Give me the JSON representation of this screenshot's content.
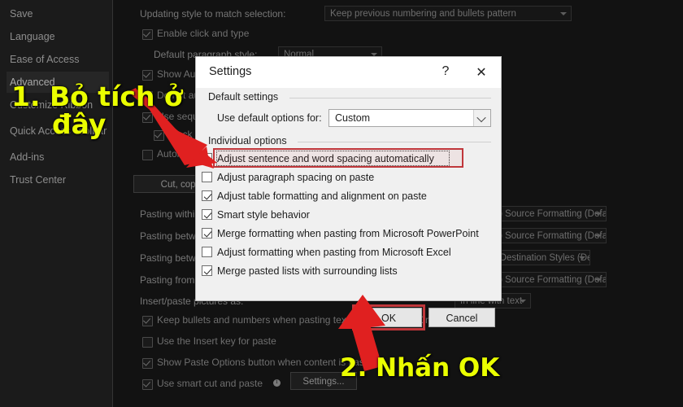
{
  "app": {
    "window_theme": "dark",
    "sidebar": {
      "items": [
        {
          "label": "Save",
          "selected": false
        },
        {
          "label": "Language",
          "selected": false
        },
        {
          "label": "Ease of Access",
          "selected": false
        },
        {
          "label": "Advanced",
          "selected": true
        },
        {
          "label": "Customize Ribbon",
          "selected": false
        },
        {
          "label": "Quick Access Toolbar",
          "selected": false
        },
        {
          "label": "Add-ins",
          "selected": false
        },
        {
          "label": "Trust Center",
          "selected": false
        }
      ]
    },
    "background": {
      "updating_style_label": "Updating style to match selection:",
      "updating_style_value": "Keep previous numbering and bullets pattern",
      "enable_click_and_type": "Enable click and type",
      "default_paragraph_style_label": "Default paragraph style:",
      "default_paragraph_style_value": "Normal",
      "show_autocomplete": "Show AutoComplete suggestions",
      "do_not_auto_hyperlink": "Do not automatically hyperlink screenshot",
      "segue_option": "Use sequence numbers for comments",
      "t_option": "Track moves",
      "automatic_option": "Automatically create drawing canvas when inserting AutoShapes",
      "cut_copy_paste_header": "Cut, copy, and paste",
      "paste_rows": [
        {
          "label": "Pasting within the same document:",
          "value": "Keep Source Formatting (Default)"
        },
        {
          "label": "Pasting between documents:",
          "value": "Keep Source Formatting (Default)"
        },
        {
          "label": "Pasting between documents when style definitions conflict:",
          "value": "Use Destination Styles (Default)"
        },
        {
          "label": "Pasting from other programs:",
          "value": "Keep Source Formatting (Default)"
        }
      ],
      "insert_paste_label": "Insert/paste pictures as:",
      "insert_paste_value": "In line with text",
      "checkbox_rows": [
        {
          "label": "Keep bullets and numbers when pasting text with Keep Text Only option",
          "checked": true
        },
        {
          "label": "Use the Insert key for paste",
          "checked": false
        },
        {
          "label": "Show Paste Options button when content is pasted",
          "checked": true
        },
        {
          "label": "Use smart cut and paste",
          "checked": true
        }
      ],
      "settings_button": "Settings..."
    }
  },
  "dialog": {
    "title": "Settings",
    "help_icon": "?",
    "close_icon": "✕",
    "groups": {
      "default_settings": "Default settings",
      "individual_options": "Individual options"
    },
    "use_default_options_label": "Use default options for:",
    "use_default_options_value": "Custom",
    "options": [
      {
        "label": "Adjust sentence and word spacing automatically",
        "checked": false,
        "highlighted": true
      },
      {
        "label": "Adjust paragraph spacing on paste",
        "checked": false,
        "highlighted": false
      },
      {
        "label": "Adjust table formatting and alignment on paste",
        "checked": true,
        "highlighted": false
      },
      {
        "label": "Smart style behavior",
        "checked": true,
        "highlighted": false
      },
      {
        "label": "Merge formatting when pasting from Microsoft PowerPoint",
        "checked": true,
        "highlighted": false
      },
      {
        "label": "Adjust formatting when pasting from Microsoft Excel",
        "checked": false,
        "highlighted": false
      },
      {
        "label": "Merge pasted lists with surrounding lists",
        "checked": true,
        "highlighted": false
      }
    ],
    "ok_button": "OK",
    "cancel_button": "Cancel"
  },
  "annotations": {
    "step1_line1": "1. Bỏ tích ở",
    "step1_line2": "đây",
    "step2": "2. Nhấn OK",
    "highlight_color": "#c0373b",
    "annotation_color": "#eaff00",
    "arrow_color": "#e02020"
  }
}
